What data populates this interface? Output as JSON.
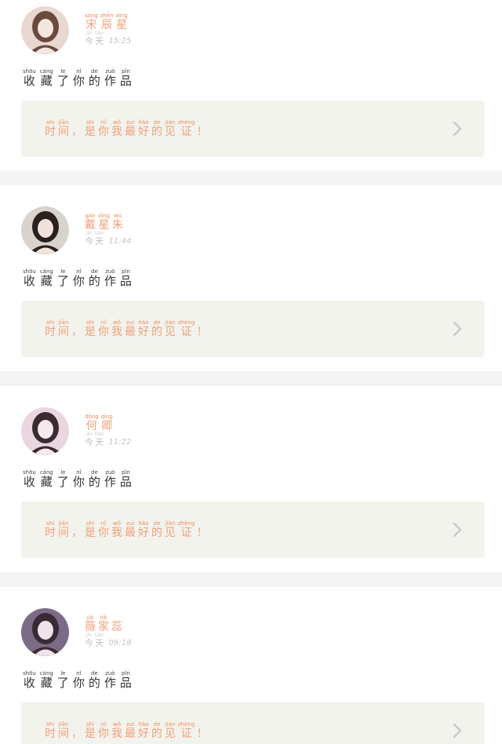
{
  "feed": [
    {
      "user": {
        "name": [
          {
            "py": "sòng",
            "ch": "宋"
          },
          {
            "py": "zhēn",
            "ch": "辰"
          },
          {
            "py": "xīng",
            "ch": "星"
          }
        ],
        "day": [
          {
            "py": "jīn",
            "ch": "今"
          },
          {
            "py": "tiān",
            "ch": "天"
          }
        ],
        "time": "15:25"
      },
      "action": [
        {
          "py": "shōu",
          "ch": "收"
        },
        {
          "py": "cáng",
          "ch": "藏"
        },
        {
          "py": "le",
          "ch": "了"
        },
        {
          "py": "nǐ",
          "ch": "你"
        },
        {
          "py": "de",
          "ch": "的"
        },
        {
          "py": "zuò",
          "ch": "作"
        },
        {
          "py": "pǐn",
          "ch": "品"
        }
      ],
      "quote": [
        {
          "py": "shí",
          "ch": "时"
        },
        {
          "py": "jiān",
          "ch": "间"
        },
        {
          "py": "",
          "ch": "，"
        },
        {
          "py": "shì",
          "ch": "是"
        },
        {
          "py": "nǐ",
          "ch": "你"
        },
        {
          "py": "wǒ",
          "ch": "我"
        },
        {
          "py": "zuì",
          "ch": "最"
        },
        {
          "py": "hǎo",
          "ch": "好"
        },
        {
          "py": "de",
          "ch": "的"
        },
        {
          "py": "jiàn",
          "ch": "见"
        },
        {
          "py": "zhèng",
          "ch": "证"
        },
        {
          "py": "",
          "ch": "!"
        }
      ],
      "avatar_colors": [
        "#e8d8d0",
        "#6b4a3e",
        "#f3e6df"
      ]
    },
    {
      "user": {
        "name": [
          {
            "py": "gāo",
            "ch": "戴"
          },
          {
            "py": "xīng",
            "ch": "星"
          },
          {
            "py": "wú",
            "ch": "朱"
          }
        ],
        "day": [
          {
            "py": "jīn",
            "ch": "今"
          },
          {
            "py": "tiān",
            "ch": "天"
          }
        ],
        "time": "11:44"
      },
      "action": [
        {
          "py": "shōu",
          "ch": "收"
        },
        {
          "py": "cáng",
          "ch": "藏"
        },
        {
          "py": "le",
          "ch": "了"
        },
        {
          "py": "nǐ",
          "ch": "你"
        },
        {
          "py": "de",
          "ch": "的"
        },
        {
          "py": "zuò",
          "ch": "作"
        },
        {
          "py": "pǐn",
          "ch": "品"
        }
      ],
      "quote": [
        {
          "py": "shí",
          "ch": "时"
        },
        {
          "py": "jiān",
          "ch": "间"
        },
        {
          "py": "",
          "ch": "，"
        },
        {
          "py": "shì",
          "ch": "是"
        },
        {
          "py": "nǐ",
          "ch": "你"
        },
        {
          "py": "wǒ",
          "ch": "我"
        },
        {
          "py": "zuì",
          "ch": "最"
        },
        {
          "py": "hǎo",
          "ch": "好"
        },
        {
          "py": "de",
          "ch": "的"
        },
        {
          "py": "jiàn",
          "ch": "见"
        },
        {
          "py": "zhèng",
          "ch": "证"
        },
        {
          "py": "",
          "ch": "!"
        }
      ],
      "avatar_colors": [
        "#d8d3cc",
        "#2b2020",
        "#f1e3dc"
      ]
    },
    {
      "user": {
        "name": [
          {
            "py": "dòng",
            "ch": "何"
          },
          {
            "py": "qìng",
            "ch": "卿"
          }
        ],
        "day": [
          {
            "py": "jīn",
            "ch": "今"
          },
          {
            "py": "tiān",
            "ch": "天"
          }
        ],
        "time": "11:22"
      },
      "action": [
        {
          "py": "shōu",
          "ch": "收"
        },
        {
          "py": "cáng",
          "ch": "藏"
        },
        {
          "py": "le",
          "ch": "了"
        },
        {
          "py": "nǐ",
          "ch": "你"
        },
        {
          "py": "de",
          "ch": "的"
        },
        {
          "py": "zuò",
          "ch": "作"
        },
        {
          "py": "pǐn",
          "ch": "品"
        }
      ],
      "quote": [
        {
          "py": "shí",
          "ch": "时"
        },
        {
          "py": "jiān",
          "ch": "间"
        },
        {
          "py": "",
          "ch": "，"
        },
        {
          "py": "shì",
          "ch": "是"
        },
        {
          "py": "nǐ",
          "ch": "你"
        },
        {
          "py": "wǒ",
          "ch": "我"
        },
        {
          "py": "zuì",
          "ch": "最"
        },
        {
          "py": "hǎo",
          "ch": "好"
        },
        {
          "py": "de",
          "ch": "的"
        },
        {
          "py": "jiàn",
          "ch": "见"
        },
        {
          "py": "zhèng",
          "ch": "证"
        },
        {
          "py": "",
          "ch": "!"
        }
      ],
      "avatar_colors": [
        "#e9d6e0",
        "#3a2b30",
        "#f5e8ee"
      ]
    },
    {
      "user": {
        "name": [
          {
            "py": "jiǎ",
            "ch": "薇"
          },
          {
            "py": "jiā",
            "ch": "家"
          },
          {
            "py": "",
            "ch": "蕊"
          }
        ],
        "day": [
          {
            "py": "jīn",
            "ch": "今"
          },
          {
            "py": "tiān",
            "ch": "天"
          }
        ],
        "time": "09:18"
      },
      "action": [
        {
          "py": "shōu",
          "ch": "收"
        },
        {
          "py": "cáng",
          "ch": "藏"
        },
        {
          "py": "le",
          "ch": "了"
        },
        {
          "py": "nǐ",
          "ch": "你"
        },
        {
          "py": "de",
          "ch": "的"
        },
        {
          "py": "zuò",
          "ch": "作"
        },
        {
          "py": "pǐn",
          "ch": "品"
        }
      ],
      "quote": [
        {
          "py": "shí",
          "ch": "时"
        },
        {
          "py": "jiān",
          "ch": "间"
        },
        {
          "py": "",
          "ch": "，"
        },
        {
          "py": "shì",
          "ch": "是"
        },
        {
          "py": "nǐ",
          "ch": "你"
        },
        {
          "py": "wǒ",
          "ch": "我"
        },
        {
          "py": "zuì",
          "ch": "最"
        },
        {
          "py": "hǎo",
          "ch": "好"
        },
        {
          "py": "de",
          "ch": "的"
        },
        {
          "py": "jiàn",
          "ch": "见"
        },
        {
          "py": "zhèng",
          "ch": "证"
        },
        {
          "py": "",
          "ch": "!"
        }
      ],
      "avatar_colors": [
        "#7b6b86",
        "#3a2a35",
        "#efe2ea"
      ]
    }
  ],
  "icons": {
    "chevron": "chevron-right-icon"
  },
  "colors": {
    "accent": "#f0a07a",
    "quote_bg": "#f3f3ee",
    "separator": "#f4f4f4"
  }
}
